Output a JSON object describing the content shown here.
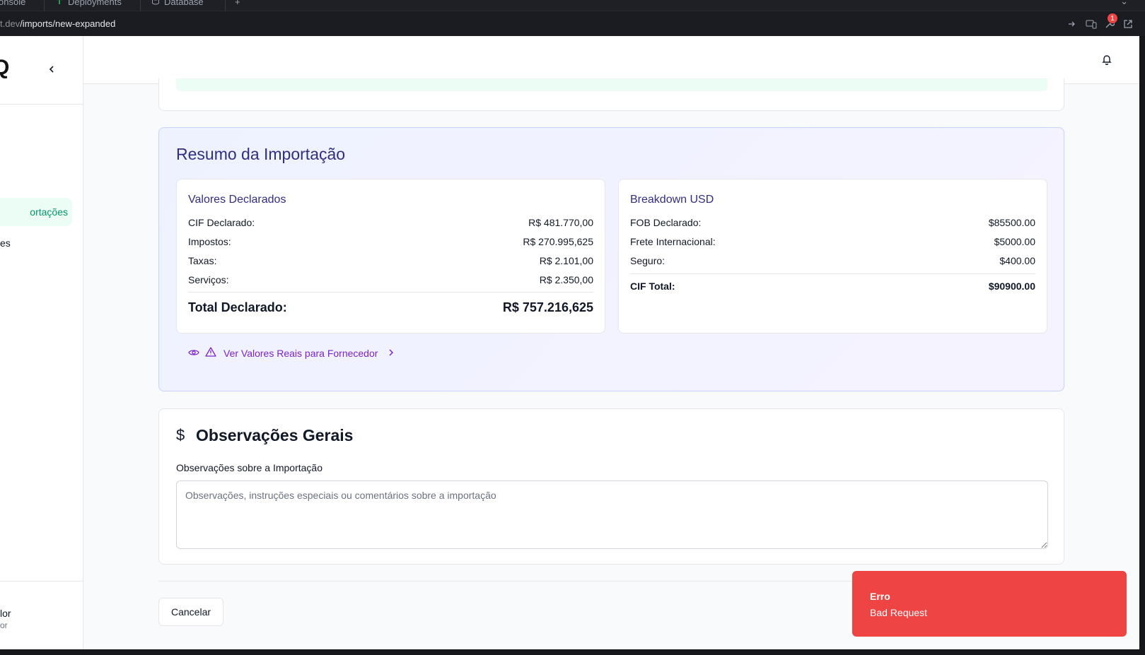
{
  "browser": {
    "tabs": [
      {
        "label": "onsole",
        "icon": "terminal-icon"
      },
      {
        "label": "Deployments",
        "icon": "deploy-icon"
      },
      {
        "label": "Database",
        "icon": "database-icon"
      }
    ],
    "new_tab": "+",
    "url_prefix": "t.dev",
    "url_path": "/imports/new-expanded",
    "notification_count": "1"
  },
  "sidebar": {
    "logo": "Q",
    "nav_active": "ortações",
    "nav_item": "es",
    "user_name": "lor",
    "user_role": "or"
  },
  "summary": {
    "title": "Resumo da Importação",
    "declared": {
      "title": "Valores Declarados",
      "rows": [
        {
          "label": "CIF Declarado:",
          "value": "R$ 481.770,00"
        },
        {
          "label": "Impostos:",
          "value": "R$ 270.995,625"
        },
        {
          "label": "Taxas:",
          "value": "R$ 2.101,00"
        },
        {
          "label": "Serviços:",
          "value": "R$ 2.350,00"
        }
      ],
      "total_label": "Total Declarado:",
      "total_value": "R$ 757.216,625"
    },
    "usd": {
      "title": "Breakdown USD",
      "rows": [
        {
          "label": "FOB Declarado:",
          "value": "$85500.00"
        },
        {
          "label": "Frete Internacional:",
          "value": "$5000.00"
        },
        {
          "label": "Seguro:",
          "value": "$400.00"
        }
      ],
      "total_label": "CIF Total:",
      "total_value": "$90900.00"
    },
    "reveal_link": "Ver Valores Reais para Fornecedor"
  },
  "observations": {
    "icon": "$",
    "title": "Observações Gerais",
    "field_label": "Observações sobre a Importação",
    "placeholder": "Observações, instruções especiais ou comentários sobre a importação",
    "value": ""
  },
  "actions": {
    "cancel_label": "Cancelar"
  },
  "toast": {
    "title": "Erro",
    "message": "Bad Request",
    "color": "#ef4444"
  },
  "colors": {
    "accent_green": "#059669",
    "summary_title": "#312e81",
    "reveal_purple": "#7e22ce"
  }
}
